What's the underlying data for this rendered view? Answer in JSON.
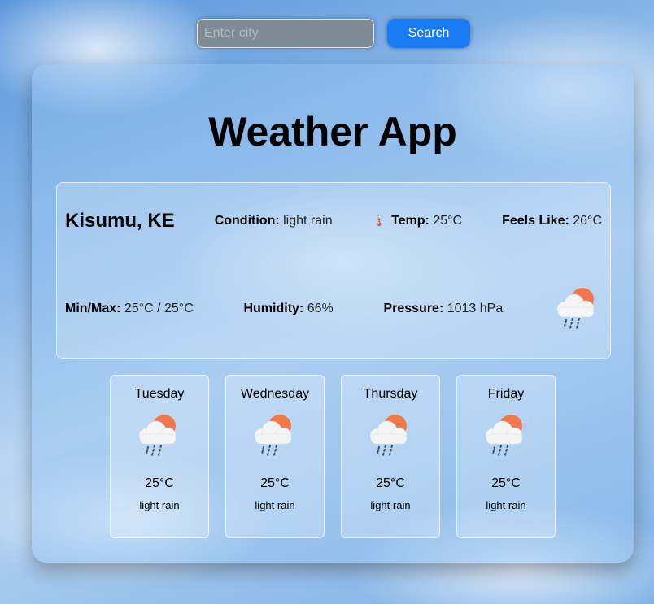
{
  "search": {
    "placeholder": "Enter city",
    "button_label": "Search"
  },
  "app_title": "Weather App",
  "current": {
    "city": "Kisumu, KE",
    "condition_label": "Condition:",
    "condition_value": "light rain",
    "temp_label": "Temp:",
    "temp_value": "25°C",
    "feels_label": "Feels Like:",
    "feels_value": "26°C",
    "minmax_label": "Min/Max:",
    "minmax_value": "25°C / 25°C",
    "humidity_label": "Humidity:",
    "humidity_value": "66%",
    "pressure_label": "Pressure:",
    "pressure_value": "1013 hPa",
    "icon": "sun-cloud-rain-icon"
  },
  "forecast": [
    {
      "day": "Tuesday",
      "temp": "25°C",
      "desc": "light rain",
      "icon": "sun-cloud-rain-icon"
    },
    {
      "day": "Wednesday",
      "temp": "25°C",
      "desc": "light rain",
      "icon": "sun-cloud-rain-icon"
    },
    {
      "day": "Thursday",
      "temp": "25°C",
      "desc": "light rain",
      "icon": "sun-cloud-rain-icon"
    },
    {
      "day": "Friday",
      "temp": "25°C",
      "desc": "light rain",
      "icon": "sun-cloud-rain-icon"
    }
  ],
  "colors": {
    "accent": "#1a7cf5",
    "sun": "#f2784b",
    "cloud": "#f5f5f5",
    "rain": "#3b4a5a"
  }
}
